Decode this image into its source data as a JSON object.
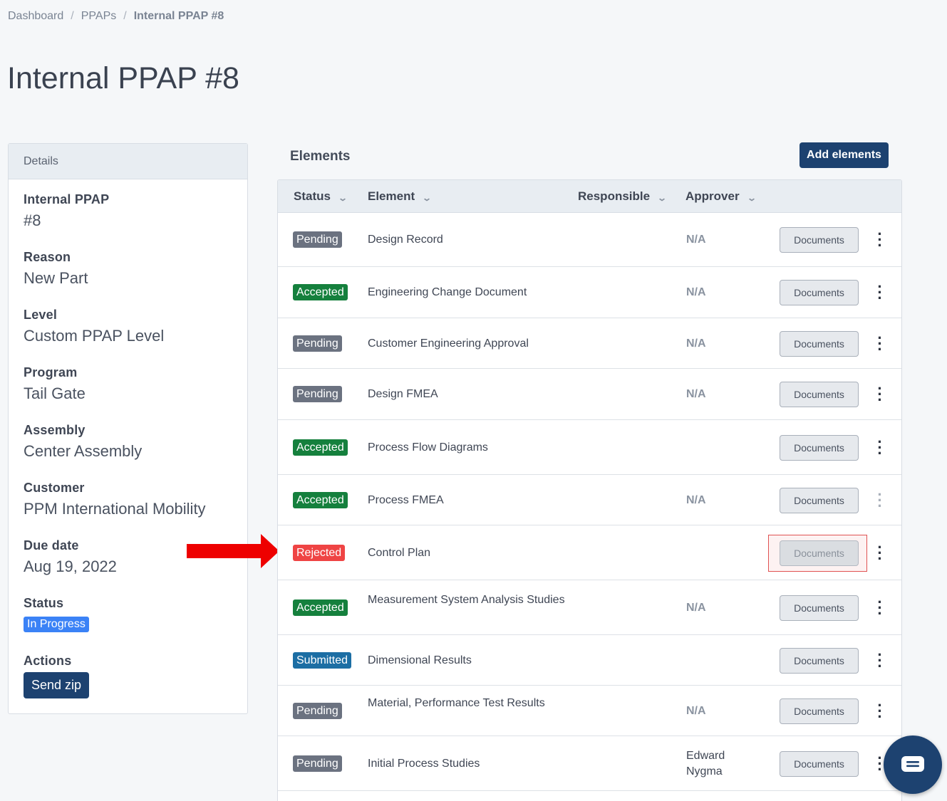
{
  "breadcrumb": {
    "items": [
      "Dashboard",
      "PPAPs"
    ],
    "current": "Internal PPAP #8",
    "separator": "/"
  },
  "page_title": "Internal PPAP #8",
  "details": {
    "header": "Details",
    "fields": [
      {
        "label": "Internal PPAP",
        "value": "#8"
      },
      {
        "label": "Reason",
        "value": "New Part"
      },
      {
        "label": "Level",
        "value": "Custom PPAP Level"
      },
      {
        "label": "Program",
        "value": "Tail Gate"
      },
      {
        "label": "Assembly",
        "value": "Center Assembly"
      },
      {
        "label": "Customer",
        "value": "PPM International Mobility"
      },
      {
        "label": "Due date",
        "value": "Aug 19, 2022"
      }
    ],
    "status_label": "Status",
    "status_value": "In Progress",
    "actions_label": "Actions",
    "send_zip": "Send zip"
  },
  "elements": {
    "title": "Elements",
    "add_button": "Add elements",
    "columns": {
      "status": "Status",
      "element": "Element",
      "responsible": "Responsible",
      "approver": "Approver"
    },
    "documents_label": "Documents",
    "rows": [
      {
        "status": "Pending",
        "element": "Design Record",
        "approver": "N/A"
      },
      {
        "status": "Accepted",
        "element": "Engineering Change Document",
        "approver": "N/A"
      },
      {
        "status": "Pending",
        "element": "Customer Engineering Approval",
        "approver": "N/A"
      },
      {
        "status": "Pending",
        "element": "Design FMEA",
        "approver": "N/A"
      },
      {
        "status": "Accepted",
        "element": "Process Flow Diagrams",
        "approver": ""
      },
      {
        "status": "Accepted",
        "element": "Process FMEA",
        "approver": "N/A"
      },
      {
        "status": "Rejected",
        "element": "Control Plan",
        "approver": ""
      },
      {
        "status": "Accepted",
        "element": "Measurement System Analysis Studies",
        "approver": "N/A"
      },
      {
        "status": "Submitted",
        "element": "Dimensional Results",
        "approver": ""
      },
      {
        "status": "Pending",
        "element": "Material, Performance Test Results",
        "approver": "N/A"
      },
      {
        "status": "Pending",
        "element": "Initial Process Studies",
        "approver": "Edward Nygma"
      }
    ]
  },
  "colors": {
    "pending": "#6b7280",
    "accepted": "#15803d",
    "rejected": "#ef4444",
    "submitted": "#1c6ea4",
    "in_progress": "#3b82f6",
    "primary_button": "#1d4270",
    "annotation_arrow": "#ee0000"
  },
  "icons": {
    "arrow": "red-arrow-icon",
    "chat": "chat-icon",
    "menu": "kebab-menu-icon",
    "sort": "chevron-down-icon"
  }
}
